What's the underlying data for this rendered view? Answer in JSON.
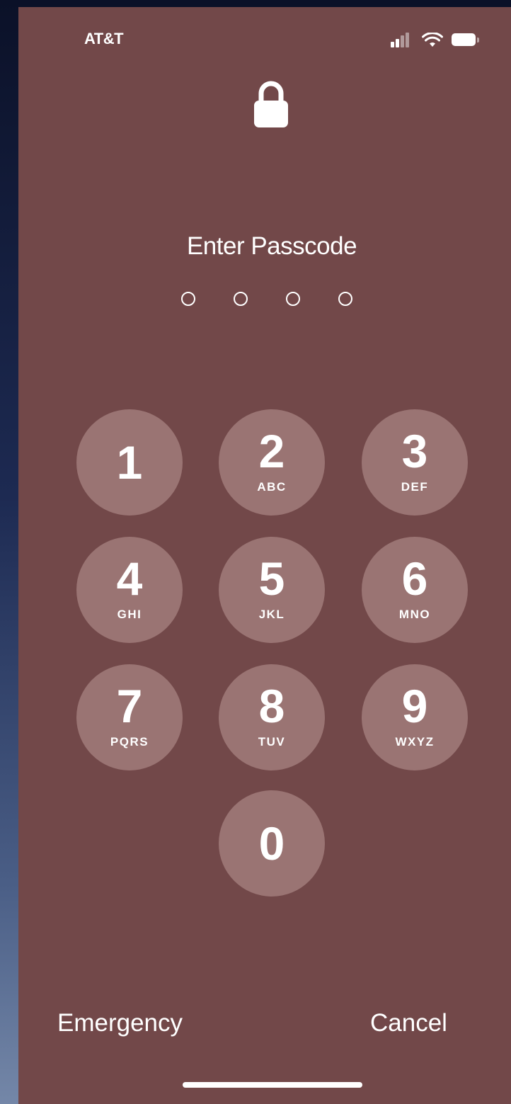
{
  "status_bar": {
    "carrier": "AT&T",
    "icons": [
      "signal-icon",
      "wifi-icon",
      "battery-icon"
    ]
  },
  "lock_screen": {
    "icon": "lock-icon",
    "title": "Enter Passcode",
    "passcode_length": 4,
    "digits_entered": 0
  },
  "keypad": {
    "keys": [
      {
        "digit": "1",
        "letters": ""
      },
      {
        "digit": "2",
        "letters": "ABC"
      },
      {
        "digit": "3",
        "letters": "DEF"
      },
      {
        "digit": "4",
        "letters": "GHI"
      },
      {
        "digit": "5",
        "letters": "JKL"
      },
      {
        "digit": "6",
        "letters": "MNO"
      },
      {
        "digit": "7",
        "letters": "PQRS"
      },
      {
        "digit": "8",
        "letters": "TUV"
      },
      {
        "digit": "9",
        "letters": "WXYZ"
      },
      {
        "digit": "0",
        "letters": ""
      }
    ]
  },
  "footer": {
    "emergency_label": "Emergency",
    "cancel_label": "Cancel"
  },
  "colors": {
    "screen_background": "#724849",
    "key_background": "#9a7473",
    "foreground": "#ffffff"
  }
}
